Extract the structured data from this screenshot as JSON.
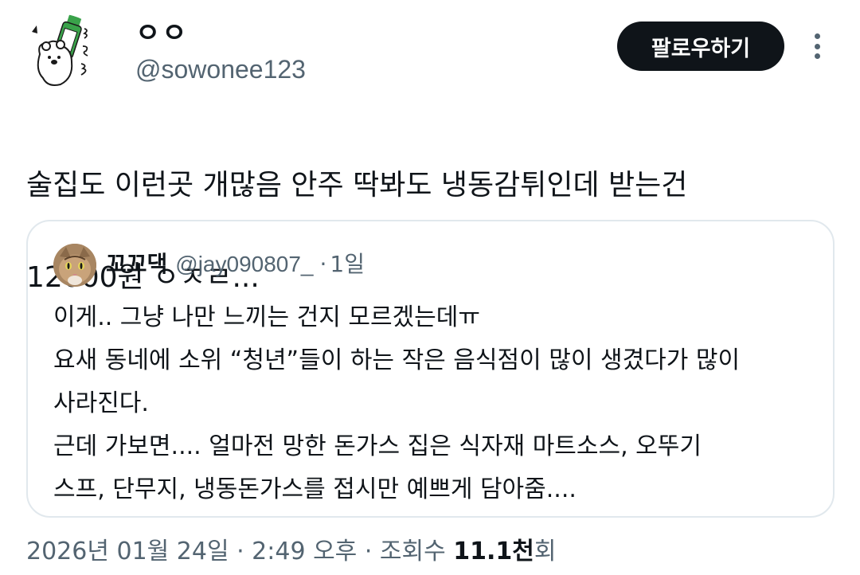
{
  "author": {
    "display_name": "ㅇㅇ",
    "handle": "@sowonee123"
  },
  "follow_button": {
    "label": "팔로우하기"
  },
  "more_icon": "more-vertical-icon",
  "tweet": {
    "text_lines": [
      "술집도 이런곳 개많음 안주 딱봐도 냉동감튀인데 받는건",
      "12000원 ㅇㅈㄹ..."
    ]
  },
  "quoted_tweet": {
    "display_name": "꼬꼬댁",
    "handle": "@jay090807_",
    "separator": "·",
    "time": "1일",
    "lines": [
      "이게.. 그냥 나만 느끼는 건지 모르겠는데ㅠ",
      "요새 동네에 소위 “청년”들이 하는 작은 음식점이 많이 생겼다가 많이",
      "사라진다.",
      "근데 가보면.... 얼마전 망한 돈가스 집은 식자재 마트소스, 오뚜기",
      "스프, 단무지, 냉동돈가스를 접시만 예쁘게 담아줌...."
    ]
  },
  "meta": {
    "date_time": "2026년 01월 24일 · 2:49 오후 · 조회수 ",
    "views_count": "11.1천",
    "views_suffix": "회"
  },
  "colors": {
    "text_primary": "#0f1419",
    "text_secondary": "#536471",
    "button_bg": "#0f1419",
    "border": "#e1e8ed"
  }
}
